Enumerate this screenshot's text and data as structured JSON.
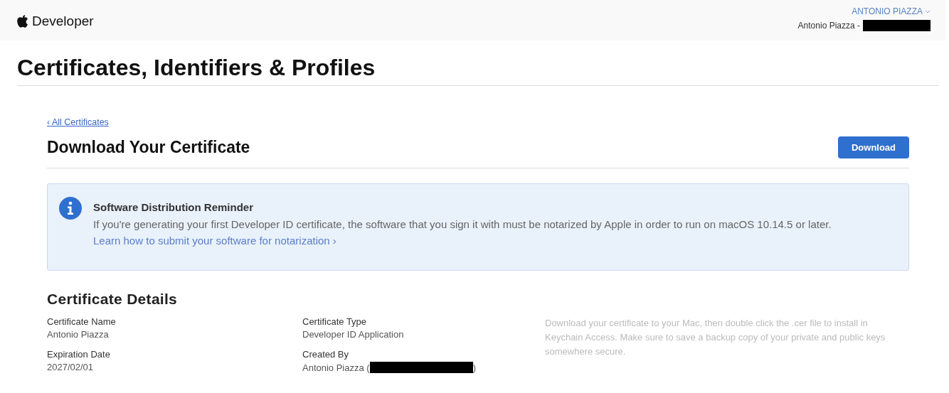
{
  "header": {
    "brand": "Developer",
    "account": {
      "name": "ANTONIO PIAZZA",
      "team": "Antonio Piazza -",
      "redacted": true
    }
  },
  "page_title": "Certificates, Identifiers & Profiles",
  "back_link": "‹ All Certificates",
  "section": {
    "title": "Download Your Certificate",
    "button": "Download"
  },
  "notice": {
    "title": "Software Distribution Reminder",
    "body": "If you're generating your first Developer ID certificate, the software that you sign it with must be notarized by Apple in order to run on macOS 10.14.5 or later.",
    "link": "Learn how to submit your software for notarization ›"
  },
  "details": {
    "title": "Certificate Details",
    "fields": [
      {
        "label": "Certificate Name",
        "value": "Antonio Piazza"
      },
      {
        "label": "Certificate Type",
        "value": "Developer ID Application"
      },
      {
        "label": "Expiration Date",
        "value": "2027/02/01"
      },
      {
        "label": "Created By",
        "value": "Antonio Piazza (",
        "after": ")",
        "redacted": true
      }
    ],
    "help": "Download your certificate to your Mac, then double click the .cer file to install in Keychain Access. Make sure to save a backup copy of your private and public keys somewhere secure."
  }
}
